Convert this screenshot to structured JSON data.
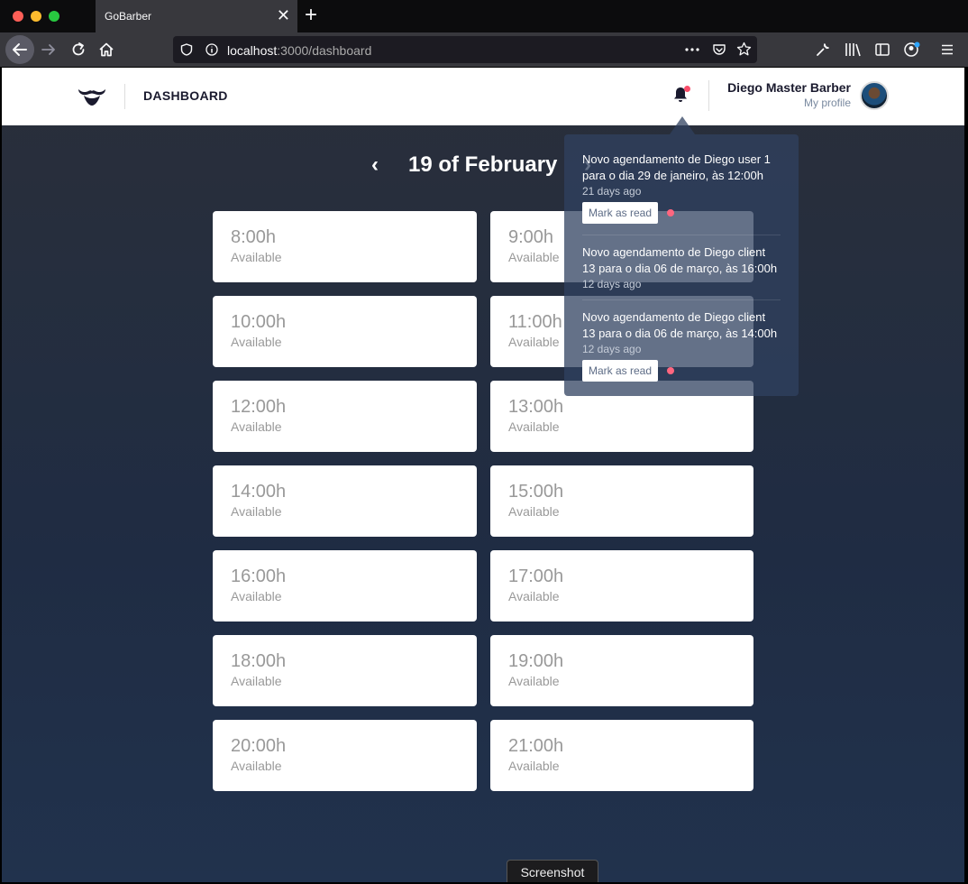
{
  "browser": {
    "tab_title": "GoBarber",
    "url_host": "localhost",
    "url_path": ":3000/dashboard",
    "close_glyph": "✕",
    "new_tab_glyph": "+"
  },
  "header": {
    "brand": "DASHBOARD",
    "user_name": "Diego Master Barber",
    "profile_link": "My profile"
  },
  "schedule": {
    "day_title": "19 of February",
    "prev_glyph": "‹",
    "next_glyph": "›",
    "slots": [
      {
        "time": "8:00h",
        "status": "Available"
      },
      {
        "time": "9:00h",
        "status": "Available"
      },
      {
        "time": "10:00h",
        "status": "Available"
      },
      {
        "time": "11:00h",
        "status": "Available"
      },
      {
        "time": "12:00h",
        "status": "Available"
      },
      {
        "time": "13:00h",
        "status": "Available"
      },
      {
        "time": "14:00h",
        "status": "Available"
      },
      {
        "time": "15:00h",
        "status": "Available"
      },
      {
        "time": "16:00h",
        "status": "Available"
      },
      {
        "time": "17:00h",
        "status": "Available"
      },
      {
        "time": "18:00h",
        "status": "Available"
      },
      {
        "time": "19:00h",
        "status": "Available"
      },
      {
        "time": "20:00h",
        "status": "Available"
      },
      {
        "time": "21:00h",
        "status": "Available"
      }
    ]
  },
  "notifications": [
    {
      "text": "Novo agendamento de Diego user 1 para o dia 29 de janeiro, às 12:00h",
      "time": "21 days ago",
      "action": "Mark as read",
      "unread": true
    },
    {
      "text": "Novo agendamento de Diego client 13 para o dia 06 de março, às 16:00h",
      "time": "12 days ago",
      "action": "",
      "unread": false
    },
    {
      "text": "Novo agendamento de Diego client 13 para o dia 06 de março, às 14:00h",
      "time": "12 days ago",
      "action": "Mark as read",
      "unread": true
    }
  ],
  "footer": {
    "screenshot_label": "Screenshot"
  },
  "colors": {
    "accent": "#f94d6a",
    "background_top": "#2a2f3a",
    "background_bottom": "#21324d"
  }
}
